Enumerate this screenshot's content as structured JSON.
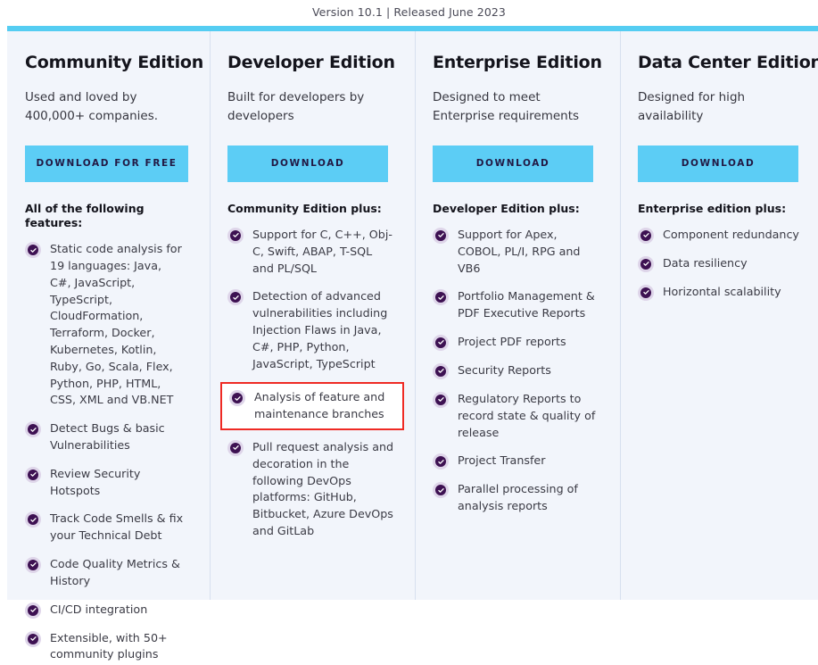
{
  "header": {
    "version_text": "Version 10.1 | Released June 2023"
  },
  "colors": {
    "accent_bar": "#55cdf2",
    "button_background": "#5ccdf5",
    "button_text": "#221944",
    "panel_background": "#f2f5fb",
    "check_ring": "#ded5e9",
    "check_fill": "#3d1152",
    "highlight_border": "#ef2a24",
    "divider": "#d7e0ef"
  },
  "columns": [
    {
      "title": "Community Edition",
      "tagline": "Used and loved by 400,000+ companies.",
      "button_label": "DOWNLOAD FOR FREE",
      "list_heading": "All of the following features:",
      "features": [
        {
          "text": "Static code analysis for 19 languages: Java, C#, JavaScript, TypeScript, CloudFormation, Terraform, Docker, Kubernetes, Kotlin, Ruby, Go, Scala, Flex, Python, PHP, HTML, CSS, XML and VB.NET",
          "highlighted": false
        },
        {
          "text": "Detect Bugs & basic Vulnerabilities",
          "highlighted": false
        },
        {
          "text": "Review Security Hotspots",
          "highlighted": false
        },
        {
          "text": "Track Code Smells & fix your Technical Debt",
          "highlighted": false
        },
        {
          "text": "Code Quality Metrics & History",
          "highlighted": false
        },
        {
          "text": "CI/CD integration",
          "highlighted": false
        },
        {
          "text": "Extensible, with 50+ community plugins",
          "highlighted": false
        }
      ]
    },
    {
      "title": "Developer Edition",
      "tagline": "Built for developers by developers",
      "button_label": "DOWNLOAD",
      "list_heading": "Community Edition plus:",
      "features": [
        {
          "text": "Support for C, C++, Obj-C, Swift, ABAP, T-SQL and PL/SQL",
          "highlighted": false
        },
        {
          "text": "Detection of advanced vulnerabilities including Injection Flaws in Java, C#, PHP, Python, JavaScript, TypeScript",
          "highlighted": false
        },
        {
          "text": "Analysis of feature and maintenance branches",
          "highlighted": true
        },
        {
          "text": "Pull request analysis and decoration in the following DevOps platforms: GitHub, Bitbucket, Azure DevOps and GitLab",
          "highlighted": false
        }
      ]
    },
    {
      "title": "Enterprise Edition",
      "tagline": "Designed to meet Enterprise requirements",
      "button_label": "DOWNLOAD",
      "list_heading": "Developer Edition plus:",
      "features": [
        {
          "text": "Support for Apex, COBOL, PL/I, RPG and VB6",
          "highlighted": false
        },
        {
          "text": "Portfolio Management & PDF Executive Reports",
          "highlighted": false
        },
        {
          "text": "Project PDF reports",
          "highlighted": false
        },
        {
          "text": "Security Reports",
          "highlighted": false
        },
        {
          "text": "Regulatory Reports to record state & quality of release",
          "highlighted": false
        },
        {
          "text": "Project Transfer",
          "highlighted": false
        },
        {
          "text": "Parallel processing of analysis reports",
          "highlighted": false
        }
      ]
    },
    {
      "title": "Data Center Edition",
      "tagline": "Designed for high availability",
      "button_label": "DOWNLOAD",
      "list_heading": "Enterprise edition plus:",
      "features": [
        {
          "text": "Component redundancy",
          "highlighted": false
        },
        {
          "text": "Data resiliency",
          "highlighted": false
        },
        {
          "text": "Horizontal scalability",
          "highlighted": false
        }
      ]
    }
  ]
}
